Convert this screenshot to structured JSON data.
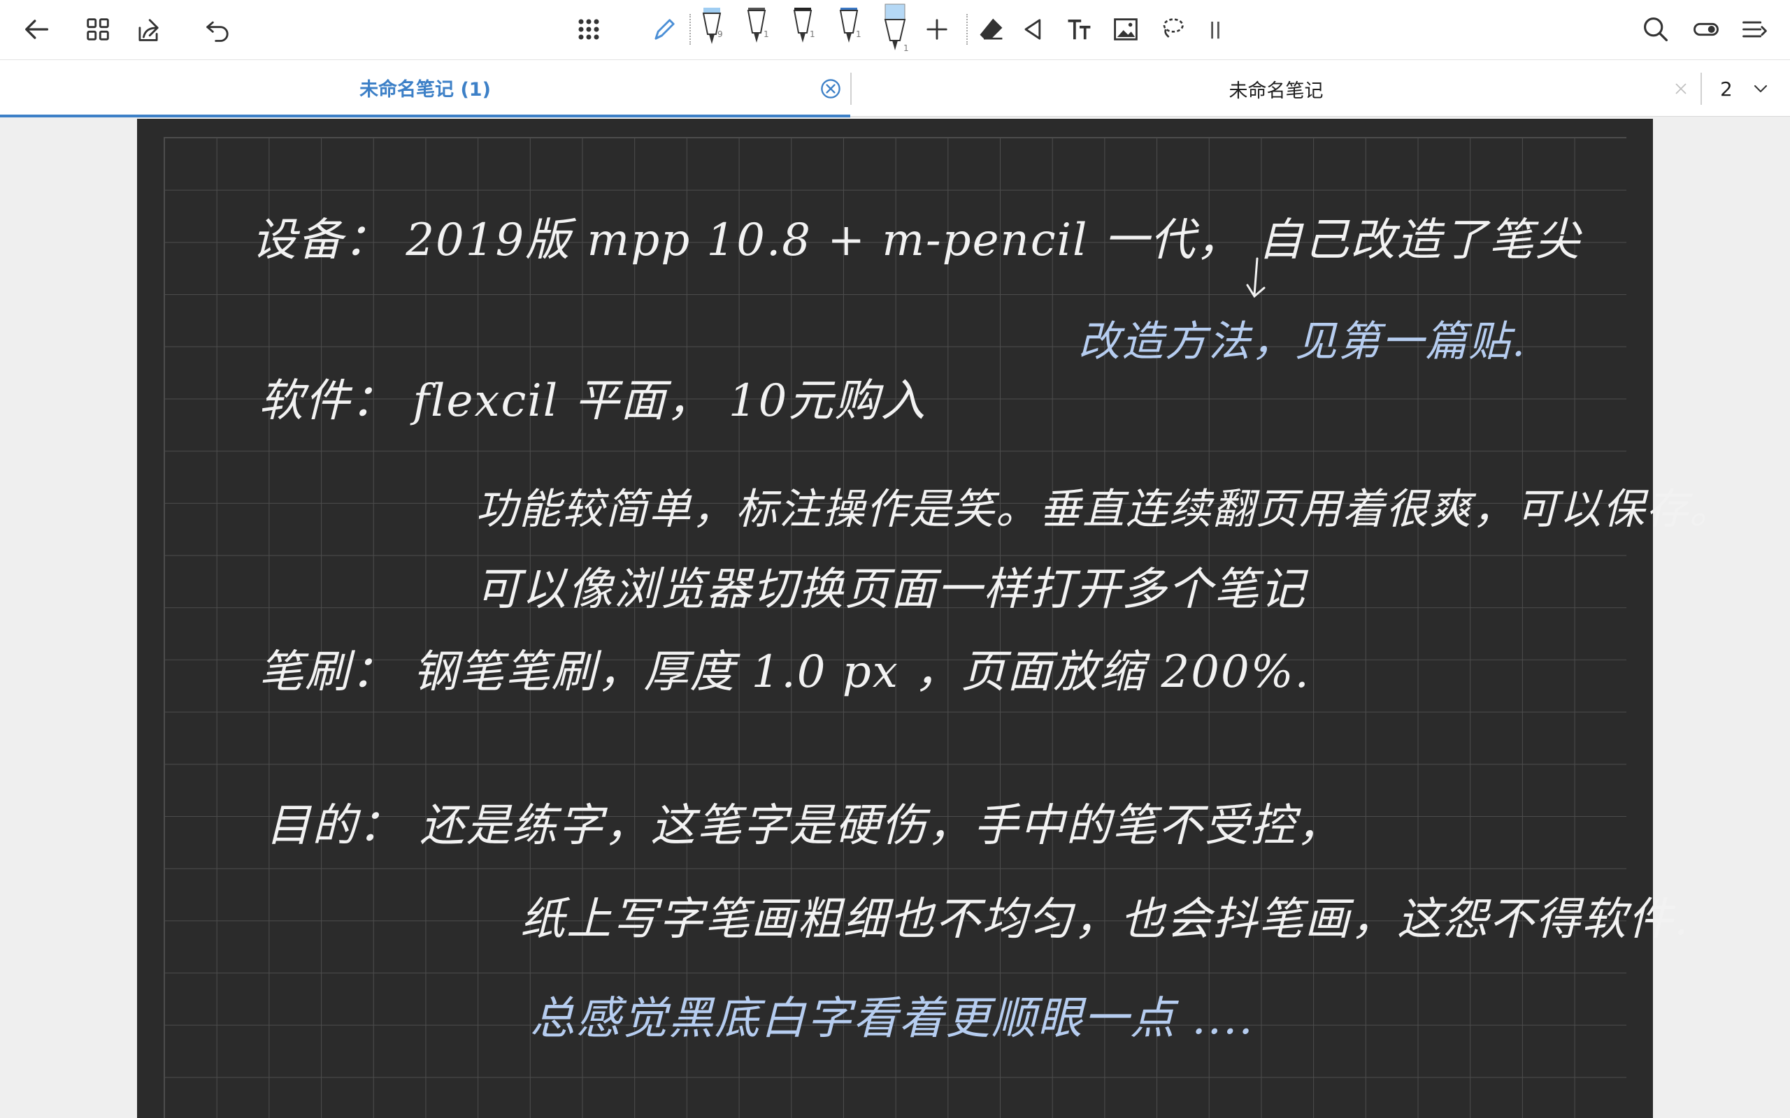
{
  "toolbar": {
    "left": [
      "back-arrow-icon",
      "grid-icon",
      "share-icon",
      "undo-icon"
    ],
    "center": [
      "apps-icon",
      "pencil-icon",
      "pen-blue-1",
      "pen-dark-1",
      "pen-dark-2",
      "pen-dark-3",
      "pen-blue-2",
      "plus-icon",
      "eraser-icon",
      "lasso-triangle-icon",
      "text-icon",
      "image-icon",
      "lasso-icon",
      "pause-icon"
    ],
    "right": [
      "search-icon",
      "toggle-icon",
      "menu-icon"
    ],
    "pen_numbers": [
      "9",
      "1",
      "1",
      "1",
      "1"
    ],
    "accent": "#3d80c7"
  },
  "tabs": [
    {
      "label": "未命名笔记 (1)",
      "active": true
    },
    {
      "label": "未命名笔记",
      "active": false
    }
  ],
  "tab_count": "2",
  "note": {
    "line1": "设备： 2019版 mpp 10.8  +  m-pencil 一代， 自己改造了笔尖",
    "line1_note": "改造方法，见第一篇贴.",
    "line2": "软件：  flexcil  平面， 10元购入",
    "line3": "功能较简单，标注操作是笑。垂直连续翻页用着很爽，可以保存。",
    "line4": "可以像浏览器切换页面一样打开多个笔记",
    "line5": "笔刷：  钢笔笔刷，厚度 1.0 px ，页面放缩 200%.",
    "line6": "目的：     还是练字，这笔字是硬伤，手中的笔不受控，",
    "line7": "纸上写字笔画粗细也不均匀，也会抖笔画，这怨不得软件.",
    "line8": "总感觉黑底白字看着更顺眼一点 ....",
    "ink_colors": {
      "white": "#f2f2f2",
      "blue": "#b6cdf0",
      "page": "#2b2b2b",
      "grid": "#4d4d4d"
    }
  }
}
